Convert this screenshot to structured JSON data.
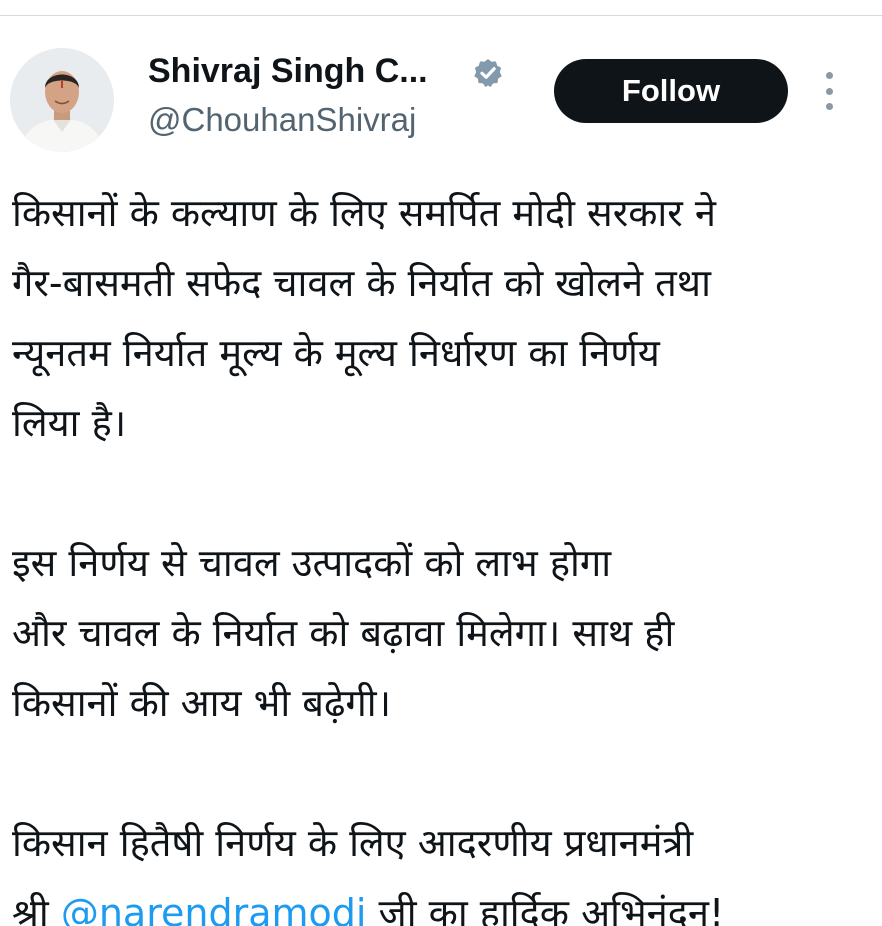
{
  "author": {
    "display_name": "Shivraj Singh C...",
    "handle": "@ChouhanShivraj",
    "verified_icon": "verified-badge-icon",
    "avatar": "profile-photo"
  },
  "actions": {
    "follow_label": "Follow",
    "more_icon": "more-vertical-icon"
  },
  "tweet": {
    "paragraph1": [
      "किसानों के कल्याण के लिए समर्पित मोदी सरकार ने",
      "गैर-बासमती सफेद चावल के निर्यात को खोलने तथा",
      "न्यूनतम निर्यात मूल्य के मूल्य निर्धारण का निर्णय",
      "लिया है।"
    ],
    "paragraph2": [
      "इस निर्णय से चावल उत्पादकों को लाभ होगा",
      "और चावल के निर्यात को बढ़ावा मिलेगा। साथ ही",
      "किसानों की आय भी बढ़ेगी।"
    ],
    "paragraph3": {
      "line1": "किसान हितैषी निर्णय के लिए आदरणीय प्रधानमंत्री",
      "line2_prefix": "श्री",
      "mention": "@narendramodi",
      "line2_suffix": "जी का हार्दिक अभिनंदन!"
    }
  },
  "colors": {
    "text": "#0f1419",
    "secondary": "#536471",
    "link": "#1d9bf0",
    "button_bg": "#0f1419",
    "button_text": "#ffffff"
  }
}
